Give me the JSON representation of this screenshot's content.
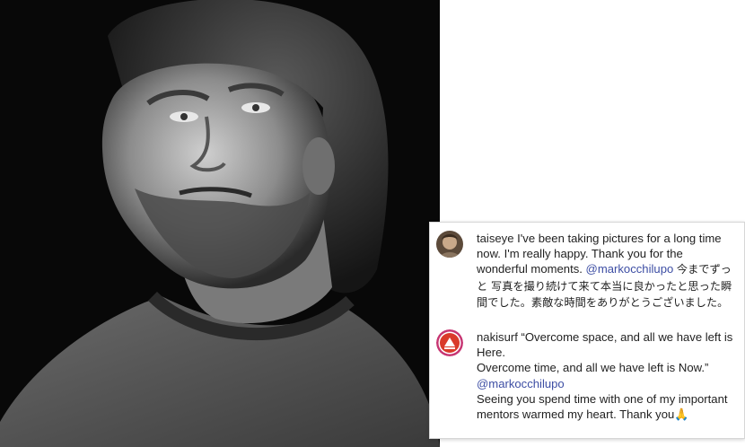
{
  "photo": {
    "alt_subject": "portrait-photo"
  },
  "comments": [
    {
      "username": "taiseye",
      "text_en": "I've been taking pictures for a long time now. I'm really happy. Thank you for the wonderful moments.",
      "mention": "@markocchilupo",
      "text_jp": "今までずっと 写真を撮り続けて来て本当に良かったと思った瞬間でした。素敵な時間をありがとうございました。"
    },
    {
      "username": "nakisurf",
      "line1": "“Overcome space, and all we have left is Here.",
      "line2": "Overcome time, and all we have left is Now.”",
      "mention": "@markocchilupo",
      "line3": "Seeing you spend time with one of my important mentors warmed my heart. Thank you",
      "emoji": "🙏"
    }
  ],
  "colors": {
    "mention": "#3d4ea4",
    "text": "#1f1f1f",
    "avatar_red": "#d93a2b"
  }
}
